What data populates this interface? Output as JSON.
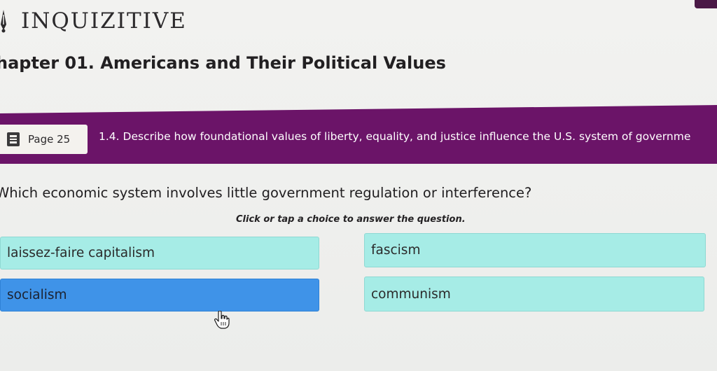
{
  "brand": {
    "name": "INQUIZITIVE",
    "icon": "pen-nib-icon"
  },
  "chapter": {
    "title": "hapter 01. Americans and Their Political Values"
  },
  "objective": {
    "page_label": "Page 25",
    "page_icon": "ebook-icon",
    "text": "1.4. Describe how foundational values of liberty, equality, and justice influence the U.S. system of governme"
  },
  "question": {
    "text": "Which economic system involves little government regulation or interference?",
    "instruction": "Click or tap a choice to answer the question."
  },
  "choices": [
    {
      "label": "laissez-faire capitalism",
      "selected": false
    },
    {
      "label": "fascism",
      "selected": false
    },
    {
      "label": "socialism",
      "selected": true
    },
    {
      "label": "communism",
      "selected": false
    }
  ],
  "colors": {
    "band_purple": "#6b1468",
    "choice_aqua": "#a6ece6",
    "choice_selected_blue": "#3f93e8"
  }
}
